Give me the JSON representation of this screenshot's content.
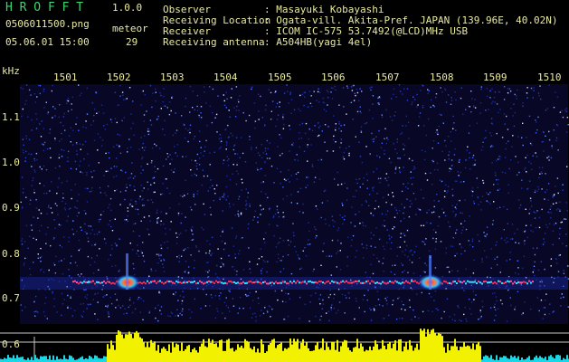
{
  "header": {
    "title": "H R O F F T",
    "version": "1.0.0",
    "filename": "0506011500.png",
    "datetime": "05.06.01 15:00",
    "meteor_label": "meteor",
    "meteor_count": "29"
  },
  "info": [
    {
      "key": "Observer",
      "value": ": Masayuki Kobayashi"
    },
    {
      "key": "Receiving Location",
      "value": ": Ogata-vill. Akita-Pref. JAPAN (139.96E, 40.02N)"
    },
    {
      "key": "Receiver",
      "value": ": ICOM IC-575 53.7492(@LCD)MHz USB"
    },
    {
      "key": "Receiving antenna",
      "value": ": A504HB(yagi 4el)"
    }
  ],
  "axis": {
    "unit": "kHz",
    "x_ticks": [
      "1501",
      "1502",
      "1503",
      "1504",
      "1505",
      "1506",
      "1507",
      "1508",
      "1509",
      "1510"
    ],
    "y_ticks": [
      "1.1",
      "1.0",
      "0.9",
      "0.8",
      "0.7",
      "0.6"
    ]
  },
  "colors": {
    "background": "#000000",
    "text": "#e9e9a0",
    "title": "#39d96a",
    "plot_bg": "#0a0a2e",
    "trace_red": "#ff2a4a",
    "power_yellow": "#f2f200",
    "power_cyan": "#19d7e6"
  }
}
